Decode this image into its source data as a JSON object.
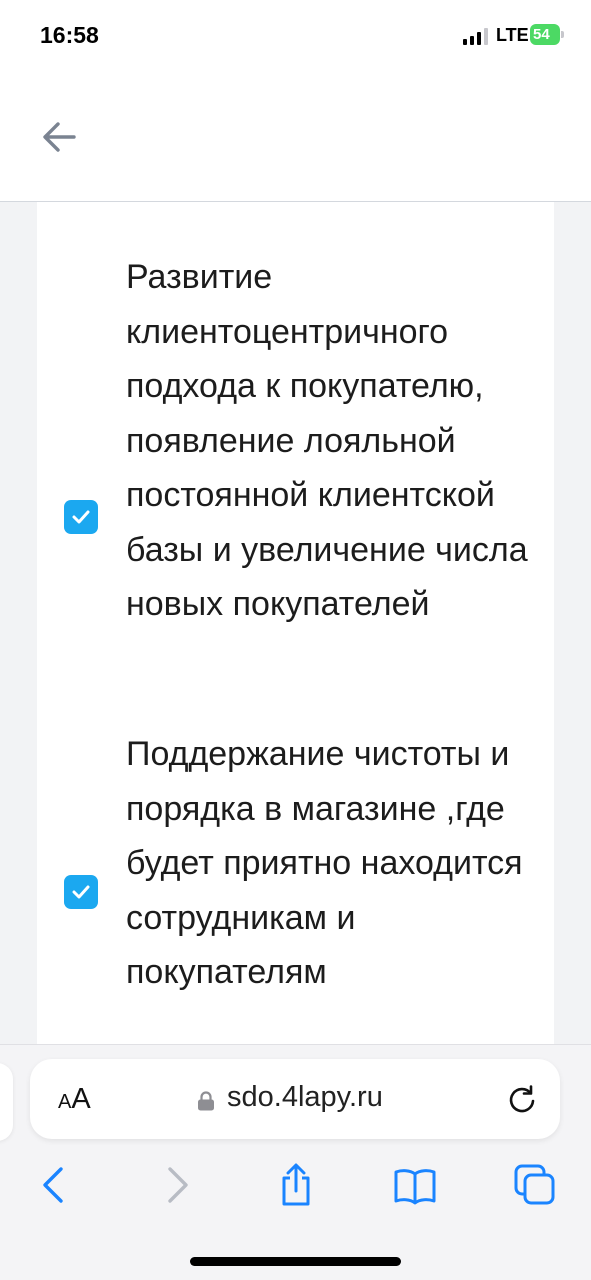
{
  "status_bar": {
    "time": "16:58",
    "network": "LTE",
    "battery": "54"
  },
  "header": {
    "back_icon": "arrow-left-icon"
  },
  "checklist": {
    "items": [
      {
        "checked": true,
        "text": "Развитие клиентоцентричного подхода к покупателю, появление лояльной постоянной клиентской базы и увеличение числа новых покупателей"
      },
      {
        "checked": true,
        "text": "Поддержание чистоты и порядка в магазине ,где будет приятно находится сотрудникам и покупателям"
      }
    ]
  },
  "browser": {
    "text_size_label_small": "A",
    "text_size_label_big": "A",
    "url": "sdo.4lapy.ru",
    "accent_color": "#1a84ff",
    "checkbox_color": "#1ba8f0"
  }
}
